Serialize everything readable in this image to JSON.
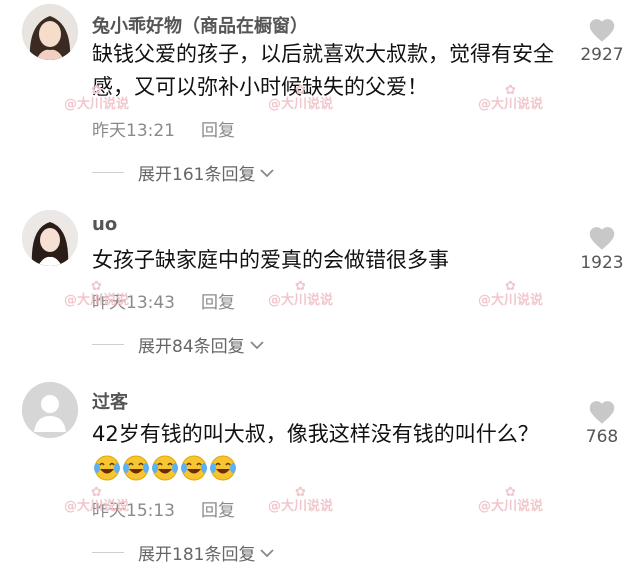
{
  "comments": [
    {
      "username": "兔小乖好物（商品在橱窗）",
      "text": "缺钱父爱的孩子，以后就喜欢大叔款，觉得有安全感，又可以弥补小时候缺失的父爱！",
      "time": "昨天13:21",
      "reply_label": "回复",
      "likes": "2927",
      "expand_label": "展开161条回复",
      "avatar": "woman-avatar"
    },
    {
      "username": "uo",
      "text": "女孩子缺家庭中的爱真的会做错很多事",
      "time": "昨天13:43",
      "reply_label": "回复",
      "likes": "1923",
      "expand_label": "展开84条回复",
      "avatar": "woman-avatar"
    },
    {
      "username": "过客",
      "text": "42岁有钱的叫大叔，像我这样没有钱的叫什么？",
      "emoji_count": 5,
      "emoji_name": "laughing-tears-emoji",
      "time": "昨天15:13",
      "reply_label": "回复",
      "likes": "768",
      "expand_label": "展开181条回复",
      "avatar": "default-avatar"
    }
  ],
  "watermark": {
    "text": "@大川说说",
    "symbol": "✿"
  },
  "icons": {
    "like": "heart-icon",
    "expand": "chevron-down-icon"
  },
  "colors": {
    "heart": "#c8c8c8",
    "meta": "#8a8a8a",
    "watermark": "#f2c7cc"
  }
}
